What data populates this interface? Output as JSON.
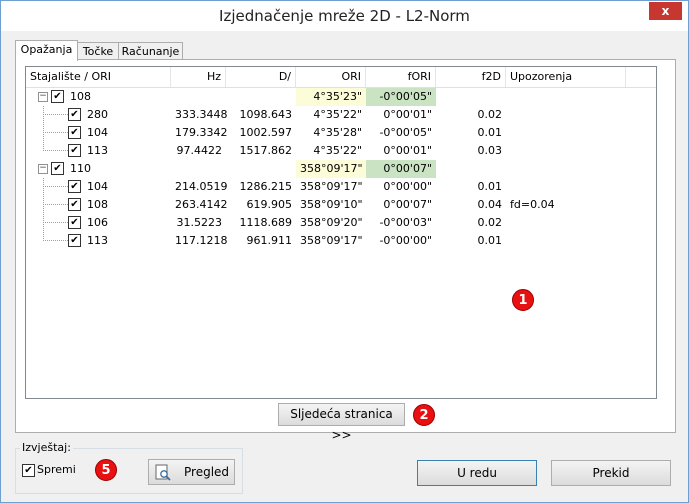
{
  "window": {
    "title": "Izjednačenje mreže 2D - L2-Norm",
    "close_label": "x"
  },
  "tabs": [
    "Opažanja",
    "Točke",
    "Računanje"
  ],
  "grid": {
    "columns": [
      "Stajalište / ORI",
      "Hz",
      "D/",
      "ORI",
      "fORI",
      "f2D",
      "Upozorenja"
    ],
    "stations": [
      {
        "name": "108",
        "checked": "✔",
        "toggle": "−",
        "ori": "4°35'23\"",
        "fori": "-0°00'05\"",
        "rows": [
          {
            "name": "280",
            "checked": "✔",
            "hz": "333.3448",
            "d": "1098.643",
            "ori": "4°35'22\"",
            "fori": "0°00'01\"",
            "f2d": "0.02",
            "warn": ""
          },
          {
            "name": "104",
            "checked": "✔",
            "hz": "179.3342",
            "d": "1002.597",
            "ori": "4°35'28\"",
            "fori": "-0°00'05\"",
            "f2d": "0.01",
            "warn": ""
          },
          {
            "name": "113",
            "checked": "✔",
            "hz": "97.4422",
            "d": "1517.862",
            "ori": "4°35'22\"",
            "fori": "0°00'01\"",
            "f2d": "0.03",
            "warn": ""
          }
        ]
      },
      {
        "name": "110",
        "checked": "✔",
        "toggle": "−",
        "ori": "358°09'17\"",
        "fori": "0°00'07\"",
        "rows": [
          {
            "name": "104",
            "checked": "✔",
            "hz": "214.0519",
            "d": "1286.215",
            "ori": "358°09'17\"",
            "fori": "0°00'00\"",
            "f2d": "0.01",
            "warn": ""
          },
          {
            "name": "108",
            "checked": "✔",
            "hz": "263.4142",
            "d": "619.905",
            "ori": "358°09'10\"",
            "fori": "0°00'07\"",
            "f2d": "0.04",
            "warn": "fd=0.04"
          },
          {
            "name": "106",
            "checked": "✔",
            "hz": "31.5223",
            "d": "1118.689",
            "ori": "358°09'20\"",
            "fori": "-0°00'03\"",
            "f2d": "0.02",
            "warn": ""
          },
          {
            "name": "113",
            "checked": "✔",
            "hz": "117.1218",
            "d": "961.911",
            "ori": "358°09'17\"",
            "fori": "-0°00'00\"",
            "f2d": "0.01",
            "warn": ""
          }
        ]
      }
    ]
  },
  "buttons": {
    "next_page": "Sljedeća stranica >>",
    "ok": "U redu",
    "cancel": "Prekid",
    "preview": "Pregled"
  },
  "report": {
    "group_label": "Izvještaj:",
    "save_label": "Spremi",
    "save_checked": "✔"
  },
  "badges": [
    "1",
    "2",
    "5"
  ],
  "colors": {
    "ori_station_bg": "#fcfcd8",
    "fori_station_bg": "#c9e3c3",
    "badge": "#e81010",
    "close": "#c7372f"
  }
}
